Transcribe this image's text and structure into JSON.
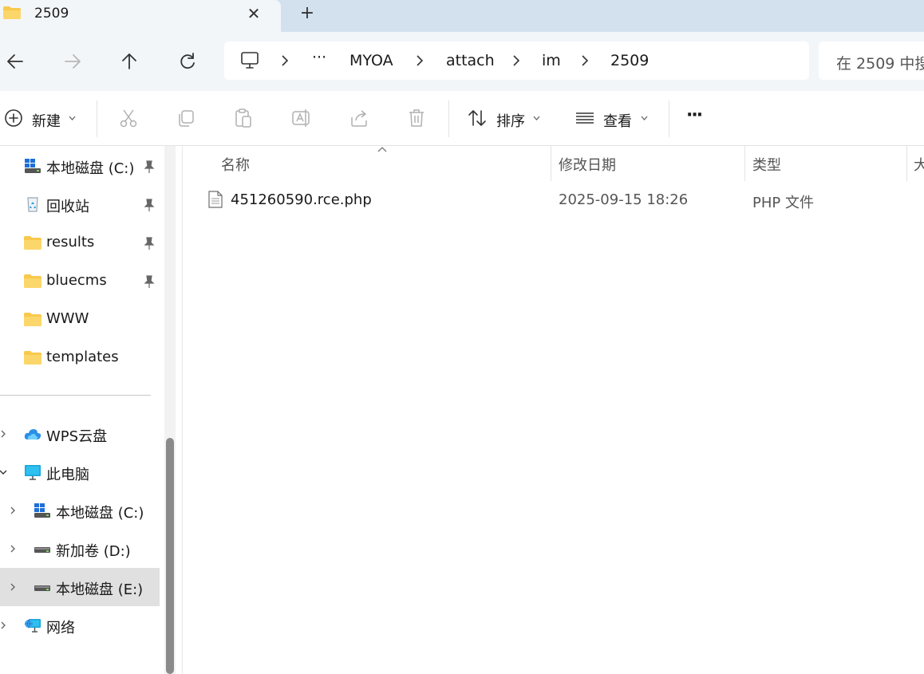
{
  "tab": {
    "title": "2509",
    "close_glyph": "✕",
    "new_tab_glyph": "+"
  },
  "address": {
    "overflow": "···",
    "crumbs": [
      "MYOA",
      "attach",
      "im",
      "2509"
    ]
  },
  "search": {
    "placeholder": "在 2509 中搜"
  },
  "toolbar": {
    "new_label": "新建",
    "sort_label": "排序",
    "view_label": "查看",
    "more_glyph": "···"
  },
  "sidebar": {
    "quick_access": [
      {
        "label": "本地磁盘 (C:)",
        "icon": "windows-drive-icon",
        "pinned": true
      },
      {
        "label": "回收站",
        "icon": "recycle-bin-icon",
        "pinned": true
      },
      {
        "label": "results",
        "icon": "folder-icon",
        "pinned": true
      },
      {
        "label": "bluecms",
        "icon": "folder-icon",
        "pinned": true
      },
      {
        "label": "WWW",
        "icon": "folder-icon",
        "pinned": false
      },
      {
        "label": "templates",
        "icon": "folder-icon",
        "pinned": false
      }
    ],
    "tree": [
      {
        "label": "WPS云盘",
        "icon": "cloud-icon"
      },
      {
        "label": "此电脑",
        "icon": "monitor-icon"
      },
      {
        "label": "本地磁盘 (C:)",
        "icon": "windows-drive-icon"
      },
      {
        "label": "新加卷 (D:)",
        "icon": "drive-icon"
      },
      {
        "label": "本地磁盘 (E:)",
        "icon": "drive-icon",
        "selected": true
      },
      {
        "label": "网络",
        "icon": "network-icon"
      }
    ]
  },
  "columns": {
    "name": "名称",
    "modified": "修改日期",
    "type": "类型",
    "size": "大"
  },
  "files": [
    {
      "name": "451260590.rce.php",
      "modified": "2025-09-15 18:26",
      "type": "PHP 文件"
    }
  ],
  "colors": {
    "chrome": "#f3f6f9",
    "tabbar": "#d3e1ef",
    "folder": "#f8c94c",
    "selected": "#e0e0e0"
  }
}
